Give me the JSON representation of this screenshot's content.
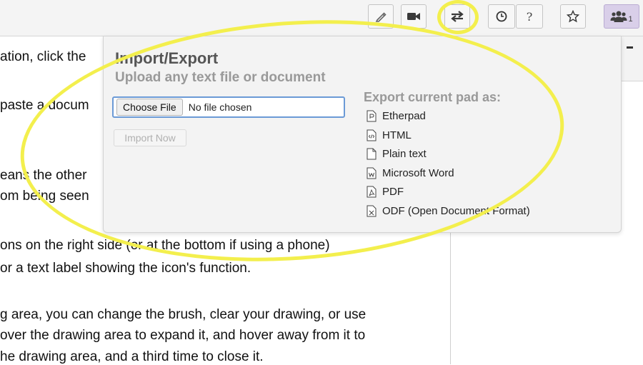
{
  "toolbar": {
    "buttons": [
      {
        "name": "pencil-button",
        "icon": "pencil-icon"
      },
      {
        "name": "video-button",
        "icon": "video-camera-icon"
      },
      {
        "name": "import-export-button",
        "icon": "swap-arrows-icon"
      },
      {
        "name": "timeslider-button",
        "icon": "clock-icon"
      },
      {
        "name": "help-button",
        "icon": "question-icon",
        "label": "?"
      },
      {
        "name": "star-button",
        "icon": "star-icon"
      },
      {
        "name": "users-button",
        "icon": "users-icon"
      }
    ],
    "users_count": "1"
  },
  "editor": {
    "lines": [
      "ation, click the",
      "paste a docum",
      "eans the other",
      "om being seen",
      "ons on the right side (or at the bottom if using a phone)",
      "or a text label showing the icon's function.",
      "g area, you can change the brush, clear your drawing, or use",
      "over the drawing area to expand it, and hover away from it to",
      "he drawing area, and a third time to close it."
    ]
  },
  "popup": {
    "title": "Import/Export",
    "subtitle": "Upload any text file or document",
    "choose_file_label": "Choose File",
    "no_file_text": "No file chosen",
    "import_button_label": "Import Now",
    "export_title": "Export current pad as:",
    "export_items": [
      {
        "label": "Etherpad",
        "icon": "file-etherpad-icon"
      },
      {
        "label": "HTML",
        "icon": "file-html-icon"
      },
      {
        "label": "Plain text",
        "icon": "file-text-icon"
      },
      {
        "label": "Microsoft Word",
        "icon": "file-word-icon"
      },
      {
        "label": "PDF",
        "icon": "file-pdf-icon"
      },
      {
        "label": "ODF (Open Document Format)",
        "icon": "file-odf-icon"
      }
    ]
  },
  "colors": {
    "highlight": "#f3ef4d",
    "users_button_bg": "#d9cfe9",
    "focus_border": "#6b9ad6"
  }
}
